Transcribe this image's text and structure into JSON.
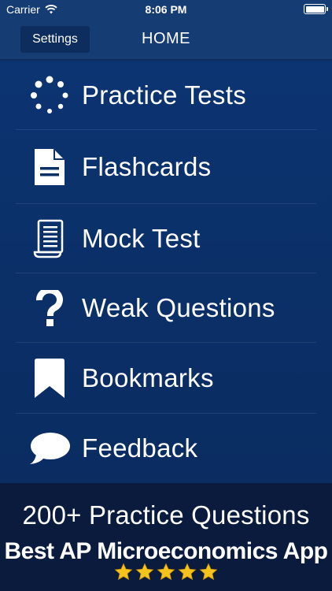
{
  "status": {
    "carrier": "Carrier",
    "time": "8:06 PM",
    "wifi_icon": "wifi-icon",
    "battery_icon": "battery-icon"
  },
  "nav": {
    "settings_label": "Settings",
    "title": "HOME"
  },
  "menu": {
    "items": [
      {
        "label": "Practice Tests",
        "icon": "loading-dots-icon"
      },
      {
        "label": "Flashcards",
        "icon": "document-icon"
      },
      {
        "label": "Mock Test",
        "icon": "scroll-icon"
      },
      {
        "label": "Weak Questions",
        "icon": "question-mark-icon"
      },
      {
        "label": "Bookmarks",
        "icon": "bookmark-icon"
      },
      {
        "label": "Feedback",
        "icon": "speech-bubble-icon"
      }
    ]
  },
  "banner": {
    "line1": "200+ Practice Questions",
    "line2": "Best AP Microeconomics App",
    "rating": 5
  },
  "colors": {
    "background": "#0b2d63",
    "navbar": "#163d73",
    "banner": "#0a1b3d",
    "star": "#f6c21c"
  }
}
